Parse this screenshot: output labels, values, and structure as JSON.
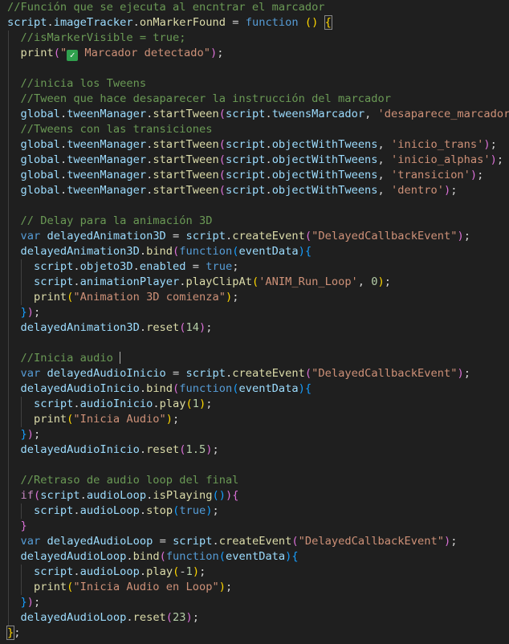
{
  "colors": {
    "background": "#1f1f1f",
    "comment": "#6a9955",
    "keyword": "#569cd6",
    "control": "#c586c0",
    "variable": "#9cdcfe",
    "function": "#dcdcaa",
    "string": "#ce9178",
    "number": "#b5cea8",
    "punct": "#d4d4d4",
    "bracket_gold": "#ffd700",
    "bracket_purple": "#da70d6",
    "bracket_blue": "#179fff"
  },
  "icons": {
    "check": "white-heavy-check-mark-emoji"
  },
  "code_lines": [
    [
      [
        "c",
        "//Función que se ejecuta al encntrar el marcador"
      ]
    ],
    [
      [
        "v",
        "script"
      ],
      [
        "p",
        "."
      ],
      [
        "v",
        "imageTracker"
      ],
      [
        "p",
        "."
      ],
      [
        "f",
        "onMarkerFound"
      ],
      [
        "p",
        " = "
      ],
      [
        "k",
        "function"
      ],
      [
        "p",
        " "
      ],
      [
        "b1",
        "()"
      ],
      [
        "p",
        " "
      ],
      [
        "b1",
        "{"
      ]
    ],
    [
      [
        "p",
        "  "
      ],
      [
        "c",
        "//isMarkerVisible = true;"
      ]
    ],
    [
      [
        "p",
        "  "
      ],
      [
        "f",
        "print"
      ],
      [
        "b2",
        "("
      ],
      [
        "s",
        "\""
      ],
      [
        "icon",
        "check"
      ],
      [
        "s",
        " Marcador detectado\""
      ],
      [
        "b2",
        ")"
      ],
      [
        "p",
        ";"
      ]
    ],
    [],
    [
      [
        "p",
        "  "
      ],
      [
        "c",
        "//inicia los Tweens"
      ]
    ],
    [
      [
        "p",
        "  "
      ],
      [
        "c",
        "//Tween que hace desaparecer la instrucción del marcador"
      ]
    ],
    [
      [
        "p",
        "  "
      ],
      [
        "v",
        "global"
      ],
      [
        "p",
        "."
      ],
      [
        "v",
        "tweenManager"
      ],
      [
        "p",
        "."
      ],
      [
        "f",
        "startTween"
      ],
      [
        "b2",
        "("
      ],
      [
        "v",
        "script"
      ],
      [
        "p",
        "."
      ],
      [
        "v",
        "tweensMarcador"
      ],
      [
        "p",
        ", "
      ],
      [
        "s",
        "'desaparece_marcador'"
      ],
      [
        "b2",
        ")"
      ],
      [
        "p",
        ";"
      ]
    ],
    [
      [
        "p",
        "  "
      ],
      [
        "c",
        "//Tweens con las transiciones"
      ]
    ],
    [
      [
        "p",
        "  "
      ],
      [
        "v",
        "global"
      ],
      [
        "p",
        "."
      ],
      [
        "v",
        "tweenManager"
      ],
      [
        "p",
        "."
      ],
      [
        "f",
        "startTween"
      ],
      [
        "b2",
        "("
      ],
      [
        "v",
        "script"
      ],
      [
        "p",
        "."
      ],
      [
        "v",
        "objectWithTweens"
      ],
      [
        "p",
        ", "
      ],
      [
        "s",
        "'inicio_trans'"
      ],
      [
        "b2",
        ")"
      ],
      [
        "p",
        ";"
      ]
    ],
    [
      [
        "p",
        "  "
      ],
      [
        "v",
        "global"
      ],
      [
        "p",
        "."
      ],
      [
        "v",
        "tweenManager"
      ],
      [
        "p",
        "."
      ],
      [
        "f",
        "startTween"
      ],
      [
        "b2",
        "("
      ],
      [
        "v",
        "script"
      ],
      [
        "p",
        "."
      ],
      [
        "v",
        "objectWithTweens"
      ],
      [
        "p",
        ", "
      ],
      [
        "s",
        "'inicio_alphas'"
      ],
      [
        "b2",
        ")"
      ],
      [
        "p",
        ";"
      ]
    ],
    [
      [
        "p",
        "  "
      ],
      [
        "v",
        "global"
      ],
      [
        "p",
        "."
      ],
      [
        "v",
        "tweenManager"
      ],
      [
        "p",
        "."
      ],
      [
        "f",
        "startTween"
      ],
      [
        "b2",
        "("
      ],
      [
        "v",
        "script"
      ],
      [
        "p",
        "."
      ],
      [
        "v",
        "objectWithTweens"
      ],
      [
        "p",
        ", "
      ],
      [
        "s",
        "'transicion'"
      ],
      [
        "b2",
        ")"
      ],
      [
        "p",
        ";"
      ]
    ],
    [
      [
        "p",
        "  "
      ],
      [
        "v",
        "global"
      ],
      [
        "p",
        "."
      ],
      [
        "v",
        "tweenManager"
      ],
      [
        "p",
        "."
      ],
      [
        "f",
        "startTween"
      ],
      [
        "b2",
        "("
      ],
      [
        "v",
        "script"
      ],
      [
        "p",
        "."
      ],
      [
        "v",
        "objectWithTweens"
      ],
      [
        "p",
        ", "
      ],
      [
        "s",
        "'dentro'"
      ],
      [
        "b2",
        ")"
      ],
      [
        "p",
        ";"
      ]
    ],
    [],
    [
      [
        "p",
        "  "
      ],
      [
        "c",
        "// Delay para la animación 3D"
      ]
    ],
    [
      [
        "p",
        "  "
      ],
      [
        "k",
        "var"
      ],
      [
        "p",
        " "
      ],
      [
        "v",
        "delayedAnimation3D"
      ],
      [
        "p",
        " = "
      ],
      [
        "v",
        "script"
      ],
      [
        "p",
        "."
      ],
      [
        "f",
        "createEvent"
      ],
      [
        "b2",
        "("
      ],
      [
        "s",
        "\"DelayedCallbackEvent\""
      ],
      [
        "b2",
        ")"
      ],
      [
        "p",
        ";"
      ]
    ],
    [
      [
        "p",
        "  "
      ],
      [
        "v",
        "delayedAnimation3D"
      ],
      [
        "p",
        "."
      ],
      [
        "f",
        "bind"
      ],
      [
        "b2",
        "("
      ],
      [
        "k",
        "function"
      ],
      [
        "b3",
        "("
      ],
      [
        "v",
        "eventData"
      ],
      [
        "b3",
        ")"
      ],
      [
        "b3",
        "{"
      ]
    ],
    [
      [
        "p",
        "    "
      ],
      [
        "v",
        "script"
      ],
      [
        "p",
        "."
      ],
      [
        "v",
        "objeto3D"
      ],
      [
        "p",
        "."
      ],
      [
        "v",
        "enabled"
      ],
      [
        "p",
        " = "
      ],
      [
        "k",
        "true"
      ],
      [
        "p",
        ";"
      ]
    ],
    [
      [
        "p",
        "    "
      ],
      [
        "v",
        "script"
      ],
      [
        "p",
        "."
      ],
      [
        "v",
        "animationPlayer"
      ],
      [
        "p",
        "."
      ],
      [
        "f",
        "playClipAt"
      ],
      [
        "b1",
        "("
      ],
      [
        "s",
        "'ANIM_Run_Loop'"
      ],
      [
        "p",
        ", "
      ],
      [
        "n",
        "0"
      ],
      [
        "b1",
        ")"
      ],
      [
        "p",
        ";"
      ]
    ],
    [
      [
        "p",
        "    "
      ],
      [
        "f",
        "print"
      ],
      [
        "b1",
        "("
      ],
      [
        "s",
        "\"Animation 3D comienza\""
      ],
      [
        "b1",
        ")"
      ],
      [
        "p",
        ";"
      ]
    ],
    [
      [
        "p",
        "  "
      ],
      [
        "b3",
        "}"
      ],
      [
        "b2",
        ")"
      ],
      [
        "p",
        ";"
      ]
    ],
    [
      [
        "p",
        "  "
      ],
      [
        "v",
        "delayedAnimation3D"
      ],
      [
        "p",
        "."
      ],
      [
        "f",
        "reset"
      ],
      [
        "b2",
        "("
      ],
      [
        "n",
        "14"
      ],
      [
        "b2",
        ")"
      ],
      [
        "p",
        ";"
      ]
    ],
    [],
    [
      [
        "p",
        "  "
      ],
      [
        "c",
        "//Inicia audio "
      ],
      [
        "cursor",
        ""
      ]
    ],
    [
      [
        "p",
        "  "
      ],
      [
        "k",
        "var"
      ],
      [
        "p",
        " "
      ],
      [
        "v",
        "delayedAudioInicio"
      ],
      [
        "p",
        " = "
      ],
      [
        "v",
        "script"
      ],
      [
        "p",
        "."
      ],
      [
        "f",
        "createEvent"
      ],
      [
        "b2",
        "("
      ],
      [
        "s",
        "\"DelayedCallbackEvent\""
      ],
      [
        "b2",
        ")"
      ],
      [
        "p",
        ";"
      ]
    ],
    [
      [
        "p",
        "  "
      ],
      [
        "v",
        "delayedAudioInicio"
      ],
      [
        "p",
        "."
      ],
      [
        "f",
        "bind"
      ],
      [
        "b2",
        "("
      ],
      [
        "k",
        "function"
      ],
      [
        "b3",
        "("
      ],
      [
        "v",
        "eventData"
      ],
      [
        "b3",
        ")"
      ],
      [
        "b3",
        "{"
      ]
    ],
    [
      [
        "p",
        "    "
      ],
      [
        "v",
        "script"
      ],
      [
        "p",
        "."
      ],
      [
        "v",
        "audioInicio"
      ],
      [
        "p",
        "."
      ],
      [
        "f",
        "play"
      ],
      [
        "b1",
        "("
      ],
      [
        "n",
        "1"
      ],
      [
        "b1",
        ")"
      ],
      [
        "p",
        ";"
      ]
    ],
    [
      [
        "p",
        "    "
      ],
      [
        "f",
        "print"
      ],
      [
        "b1",
        "("
      ],
      [
        "s",
        "\"Inicia Audio\""
      ],
      [
        "b1",
        ")"
      ],
      [
        "p",
        ";"
      ]
    ],
    [
      [
        "p",
        "  "
      ],
      [
        "b3",
        "}"
      ],
      [
        "b2",
        ")"
      ],
      [
        "p",
        ";"
      ]
    ],
    [
      [
        "p",
        "  "
      ],
      [
        "v",
        "delayedAudioInicio"
      ],
      [
        "p",
        "."
      ],
      [
        "f",
        "reset"
      ],
      [
        "b2",
        "("
      ],
      [
        "n",
        "1.5"
      ],
      [
        "b2",
        ")"
      ],
      [
        "p",
        ";"
      ]
    ],
    [],
    [
      [
        "p",
        "  "
      ],
      [
        "c",
        "//Retraso de audio loop del final"
      ]
    ],
    [
      [
        "p",
        "  "
      ],
      [
        "r",
        "if"
      ],
      [
        "b2",
        "("
      ],
      [
        "v",
        "script"
      ],
      [
        "p",
        "."
      ],
      [
        "v",
        "audioLoop"
      ],
      [
        "p",
        "."
      ],
      [
        "f",
        "isPlaying"
      ],
      [
        "b3",
        "()"
      ],
      [
        "b2",
        ")"
      ],
      [
        "b2",
        "{"
      ]
    ],
    [
      [
        "p",
        "    "
      ],
      [
        "v",
        "script"
      ],
      [
        "p",
        "."
      ],
      [
        "v",
        "audioLoop"
      ],
      [
        "p",
        "."
      ],
      [
        "f",
        "stop"
      ],
      [
        "b3",
        "("
      ],
      [
        "k",
        "true"
      ],
      [
        "b3",
        ")"
      ],
      [
        "p",
        ";"
      ]
    ],
    [
      [
        "p",
        "  "
      ],
      [
        "b2",
        "}"
      ]
    ],
    [
      [
        "p",
        "  "
      ],
      [
        "k",
        "var"
      ],
      [
        "p",
        " "
      ],
      [
        "v",
        "delayedAudioLoop"
      ],
      [
        "p",
        " = "
      ],
      [
        "v",
        "script"
      ],
      [
        "p",
        "."
      ],
      [
        "f",
        "createEvent"
      ],
      [
        "b2",
        "("
      ],
      [
        "s",
        "\"DelayedCallbackEvent\""
      ],
      [
        "b2",
        ")"
      ],
      [
        "p",
        ";"
      ]
    ],
    [
      [
        "p",
        "  "
      ],
      [
        "v",
        "delayedAudioLoop"
      ],
      [
        "p",
        "."
      ],
      [
        "f",
        "bind"
      ],
      [
        "b2",
        "("
      ],
      [
        "k",
        "function"
      ],
      [
        "b3",
        "("
      ],
      [
        "v",
        "eventData"
      ],
      [
        "b3",
        ")"
      ],
      [
        "b3",
        "{"
      ]
    ],
    [
      [
        "p",
        "    "
      ],
      [
        "v",
        "script"
      ],
      [
        "p",
        "."
      ],
      [
        "v",
        "audioLoop"
      ],
      [
        "p",
        "."
      ],
      [
        "f",
        "play"
      ],
      [
        "b1",
        "("
      ],
      [
        "p",
        "-"
      ],
      [
        "n",
        "1"
      ],
      [
        "b1",
        ")"
      ],
      [
        "p",
        ";"
      ]
    ],
    [
      [
        "p",
        "    "
      ],
      [
        "f",
        "print"
      ],
      [
        "b1",
        "("
      ],
      [
        "s",
        "\"Inicia Audio en Loop\""
      ],
      [
        "b1",
        ")"
      ],
      [
        "p",
        ";"
      ]
    ],
    [
      [
        "p",
        "  "
      ],
      [
        "b3",
        "}"
      ],
      [
        "b2",
        ")"
      ],
      [
        "p",
        ";"
      ]
    ],
    [
      [
        "p",
        "  "
      ],
      [
        "v",
        "delayedAudioLoop"
      ],
      [
        "p",
        "."
      ],
      [
        "f",
        "reset"
      ],
      [
        "b2",
        "("
      ],
      [
        "n",
        "23"
      ],
      [
        "b2",
        ")"
      ],
      [
        "p",
        ";"
      ]
    ],
    [
      [
        "b1box",
        "}"
      ],
      [
        "p",
        ";"
      ]
    ]
  ]
}
